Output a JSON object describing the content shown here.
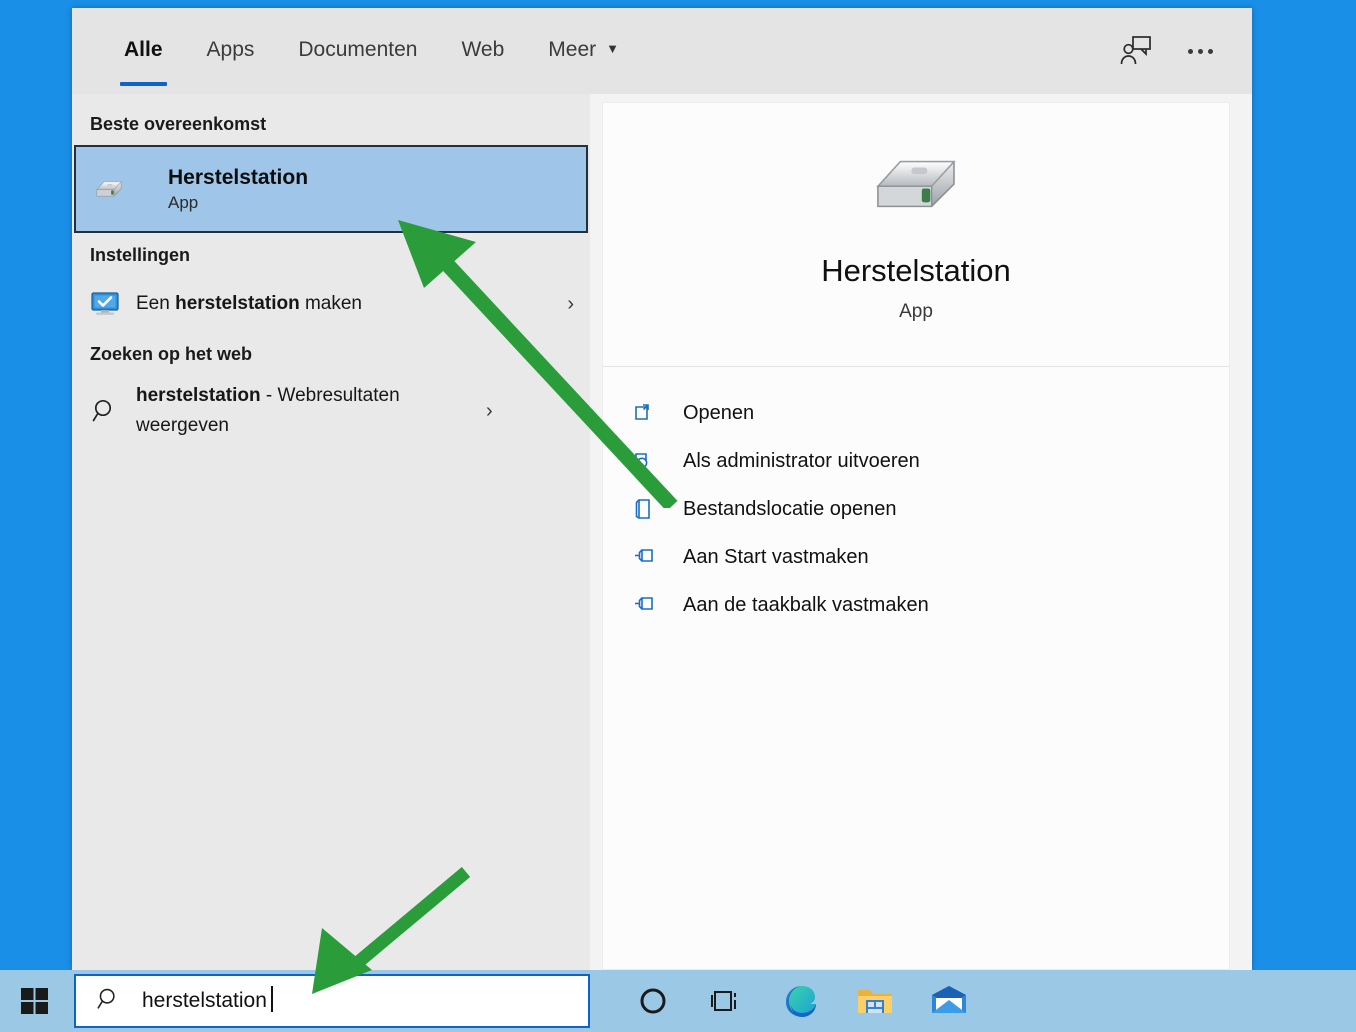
{
  "desktop": {
    "background_color": "#1a8fe8",
    "taskbar_color": "#9bc8e4"
  },
  "search_window": {
    "tabs": [
      {
        "label": "Alle",
        "active": true
      },
      {
        "label": "Apps",
        "active": false
      },
      {
        "label": "Documenten",
        "active": false
      },
      {
        "label": "Web",
        "active": false
      },
      {
        "label": "Meer",
        "active": false,
        "has_caret": true
      }
    ],
    "accent_color": "#0e63c8",
    "header_icons": [
      {
        "name": "feedback-icon"
      },
      {
        "name": "more-options-icon"
      }
    ],
    "left_pane": {
      "best_match_heading": "Beste overeenkomst",
      "best_match": {
        "title": "Herstelstation",
        "subtitle": "App",
        "icon": "hard-drive-icon",
        "selected": true,
        "selection_color": "#9fc5e8"
      },
      "settings_heading": "Instellingen",
      "settings_items": [
        {
          "label_prefix": "Een ",
          "label_bold": "herstelstation",
          "label_suffix": " maken",
          "icon": "monitor-check-icon",
          "chevron": "›"
        }
      ],
      "web_heading": "Zoeken op het web",
      "web_items": [
        {
          "label_bold": "herstelstation",
          "label_suffix": " - Webresultaten weergeven",
          "icon": "search-icon",
          "chevron": "›"
        }
      ]
    },
    "preview_pane": {
      "app_icon": "hard-drive-icon",
      "app_title": "Herstelstation",
      "app_type": "App",
      "actions": [
        {
          "label": "Openen",
          "icon": "open-icon"
        },
        {
          "label": "Als administrator uitvoeren",
          "icon": "shield-run-icon"
        },
        {
          "label": "Bestandslocatie openen",
          "icon": "folder-location-icon"
        },
        {
          "label": "Aan Start vastmaken",
          "icon": "pin-icon"
        },
        {
          "label": "Aan de taakbalk vastmaken",
          "icon": "pin-icon"
        }
      ]
    }
  },
  "taskbar": {
    "start_button": "start-icon",
    "search_query": "herstelstation",
    "search_icon": "search-icon",
    "icons": [
      {
        "name": "cortana-icon"
      },
      {
        "name": "task-view-icon"
      },
      {
        "name": "edge-browser-icon"
      },
      {
        "name": "file-explorer-icon"
      },
      {
        "name": "mail-icon"
      }
    ]
  },
  "annotations": {
    "arrow_color": "#2a9c3a",
    "arrows": [
      {
        "name": "arrow-to-best-match",
        "points_to": "Herstelstation app result"
      },
      {
        "name": "arrow-to-search-box",
        "points_to": "taskbar search box"
      }
    ]
  }
}
